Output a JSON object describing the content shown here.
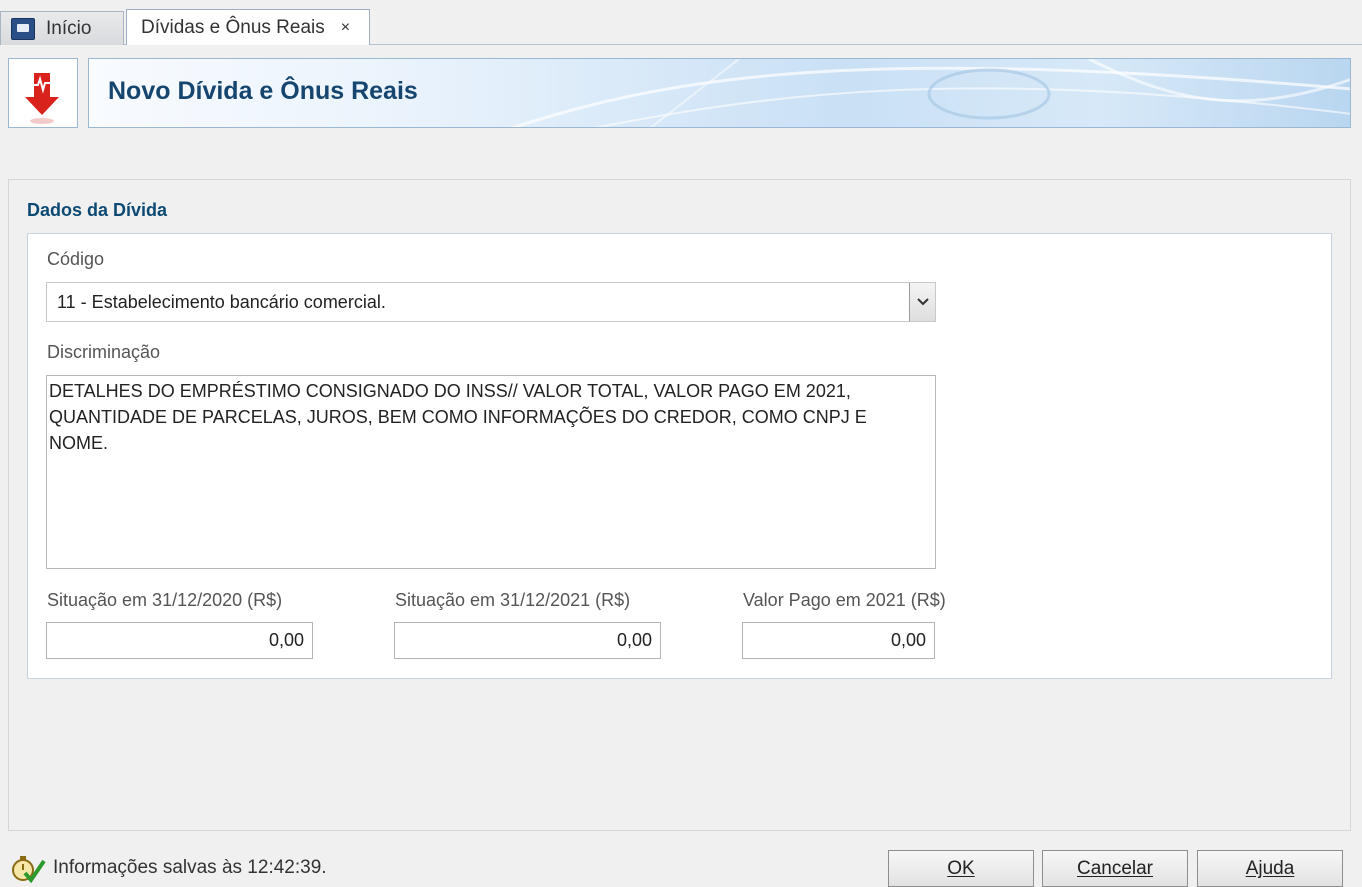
{
  "tabs": {
    "home_label": "Início",
    "active_label": "Dívidas e Ônus Reais",
    "close_glyph": "×"
  },
  "header": {
    "title": "Novo Dívida e Ônus Reais",
    "icon": "red-down-arrow-icon"
  },
  "form": {
    "section_title": "Dados da Dívida",
    "codigo_label": "Código",
    "codigo_value": "11 - Estabelecimento bancário comercial.",
    "discriminacao_label": "Discriminação",
    "discriminacao_value": "DETALHES DO EMPRÉSTIMO CONSIGNADO DO INSS// VALOR TOTAL, VALOR PAGO EM 2021,\nQUANTIDADE DE PARCELAS, JUROS, BEM COMO INFORMAÇÕES DO CREDOR, COMO CNPJ E\nNOME.",
    "situacao_2020_label": "Situação em 31/12/2020 (R$)",
    "situacao_2020_value": "0,00",
    "situacao_2021_label": "Situação em 31/12/2021 (R$)",
    "situacao_2021_value": "0,00",
    "valor_pago_label": "Valor Pago em 2021 (R$)",
    "valor_pago_value": "0,00"
  },
  "footer": {
    "status_text": "Informações salvas às 12:42:39.",
    "ok_label": "OK",
    "cancel_label": "Cancelar",
    "help_label": "Ajuda"
  },
  "colors": {
    "title_blue": "#16466f",
    "section_blue": "#0d4a73",
    "arrow_red": "#d9221c"
  }
}
